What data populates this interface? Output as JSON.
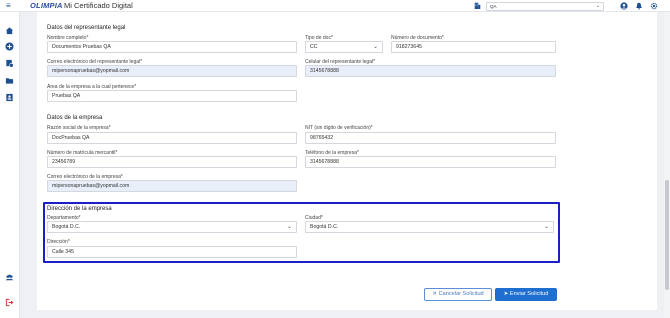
{
  "topbar": {
    "brand": "OLIMPIA",
    "title": "Mi Certificado Digital",
    "org_select": "QA"
  },
  "sections": {
    "legal_rep": "Datos del representante legal",
    "company": "Datos de la empresa",
    "address": "Dirección de la empresa"
  },
  "fields": {
    "nombre": {
      "label": "Nombre completo*",
      "value": "Documentos Pruebas QA"
    },
    "tipo_doc": {
      "label": "Tipo de doc*",
      "value": "CC"
    },
    "num_doc": {
      "label": "Número de documento*",
      "value": "918273645"
    },
    "correo_rep": {
      "label": "Correo electrónico del representante legal*",
      "value": "mipersonapruebas@yopmail.com"
    },
    "celular_rep": {
      "label": "Celular del representante legal*",
      "value": "3145678888"
    },
    "area": {
      "label": "Área de la empresa a la cual pertenece*",
      "value": "Pruebas QA"
    },
    "razon": {
      "label": "Razón social de la empresa*",
      "value": "DocPruebas QA"
    },
    "nit": {
      "label": "NIT (sin digito de verificación)*",
      "value": "98765432"
    },
    "matricula": {
      "label": "Número de matrícula mercantil*",
      "value": "23456789"
    },
    "telefono": {
      "label": "Teléfono de la empresa*",
      "value": "3145678888"
    },
    "correo_emp": {
      "label": "Correo electrónico de la empresa*",
      "value": "mipersonapruebas@yopmail.com"
    },
    "departamento": {
      "label": "Departamento*",
      "value": "Bogotá D.C."
    },
    "ciudad": {
      "label": "Ciudad*",
      "value": "Bogotá D.C."
    },
    "direccion": {
      "label": "Dirección*",
      "value": "Calle 345"
    }
  },
  "buttons": {
    "cancel": "Cancelar Solicitud",
    "send": "Enviar Solicitud"
  },
  "icons": {
    "menu": "hamburger-icon",
    "building": "building-icon",
    "user": "user-circle-icon",
    "bell": "bell-icon",
    "settings": "gear-icon"
  },
  "colors": {
    "primary": "#1f6fd1",
    "highlight_border": "#1c1ec8",
    "filled_field": "#e8effa"
  }
}
